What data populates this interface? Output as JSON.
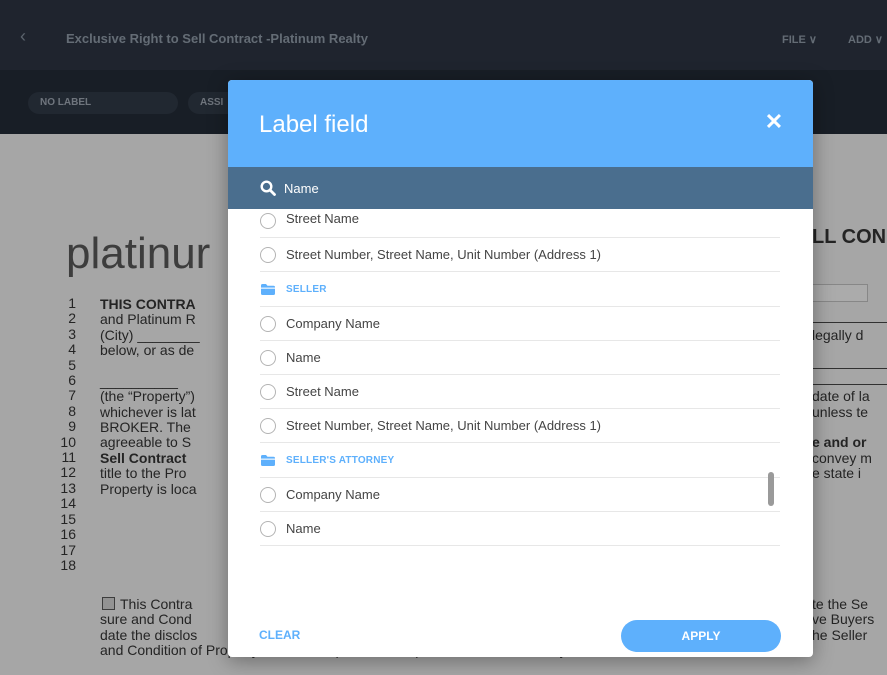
{
  "app": {
    "title": "Exclusive Right to Sell Contract -Platinum Realty",
    "back_icon": "chevron-left-icon",
    "menu": {
      "file": "FILE ∨",
      "add": "ADD ∨"
    },
    "toolbar": {
      "label_pill": "NO LABEL",
      "assign_pill": "ASSI"
    }
  },
  "document": {
    "brand": "platinur",
    "heading_right": "LL CON",
    "line_numbers": [
      "1",
      "2",
      "3",
      "4",
      "5",
      "6",
      "7",
      "8",
      "9",
      "10",
      "11",
      "12",
      "13",
      "14",
      "15",
      "16",
      "17",
      "18"
    ],
    "left_lines": [
      "THIS CONTRA",
      "and Platinum R",
      "(City) ________",
      "below, or as de",
      "",
      "__________",
      "(the “Property”)",
      "whichever is lat",
      "BROKER.  The",
      "agreeable to S",
      "Sell Contract",
      "title to the Pro",
      "Property is loca",
      "",
      "This Contra",
      "sure and Cond",
      "date the disclos",
      "and Condition of Property Addendum (Vacant Land) should be used in conjunction with the Se"
    ],
    "right_lines": {
      "l3": "legally d",
      "l7": "date of la",
      "l8": "unless te",
      "l10": "e and or",
      "l11": "convey m",
      "l12": "e state i",
      "l15": "te the Se",
      "l16": "ve Buyers",
      "l17": "he Seller"
    }
  },
  "modal": {
    "title": "Label field",
    "close_icon": "close-icon",
    "search": {
      "value": "",
      "placeholder": "Name",
      "icon": "search-icon"
    },
    "rows": {
      "partial_top": "Street Name",
      "r1": "Street Number, Street Name, Unit Number (Address 1)",
      "group_seller": "SELLER",
      "r2": "Company Name",
      "r3": "Name",
      "r4": "Street Name",
      "r5": "Street Number, Street Name, Unit Number (Address 1)",
      "group_sellers_attorney": "SELLER'S ATTORNEY",
      "r6": "Company Name",
      "r7": "Name"
    },
    "clear_label": "CLEAR",
    "apply_label": "APPLY"
  },
  "colors": {
    "accent": "#5eb0fc",
    "search_bar": "#4a6e8e",
    "app_header": "#2b3340"
  }
}
